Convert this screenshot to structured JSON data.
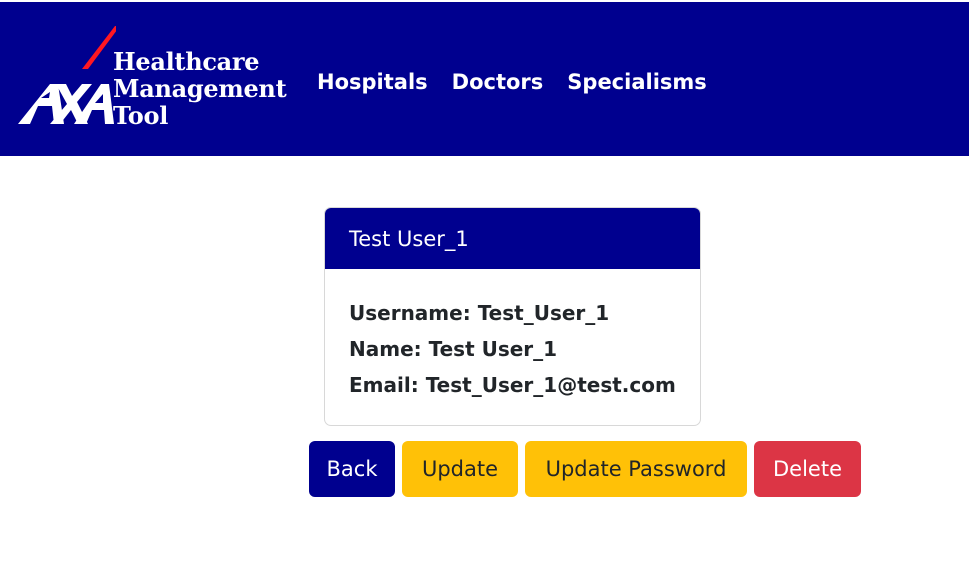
{
  "brand": {
    "logo_letters": "AXA",
    "line1": "Healthcare",
    "line2": "Management",
    "line3": "Tool",
    "colors": {
      "navy": "#00008f",
      "red": "#ff1721",
      "white": "#ffffff"
    }
  },
  "nav": {
    "items": [
      {
        "label": "Hospitals"
      },
      {
        "label": "Doctors"
      },
      {
        "label": "Specialisms"
      }
    ]
  },
  "card": {
    "title": "Test User_1",
    "username_label": "Username:",
    "username_value": "Test_User_1",
    "name_label": "Name:",
    "name_value": "Test User_1",
    "email_label": "Email:",
    "email_value": "Test_User_1@test.com"
  },
  "actions": {
    "back": "Back",
    "update": "Update",
    "update_password": "Update Password",
    "delete": "Delete",
    "colors": {
      "primary": "#00008f",
      "warning": "#ffc107",
      "danger": "#dc3545"
    }
  }
}
